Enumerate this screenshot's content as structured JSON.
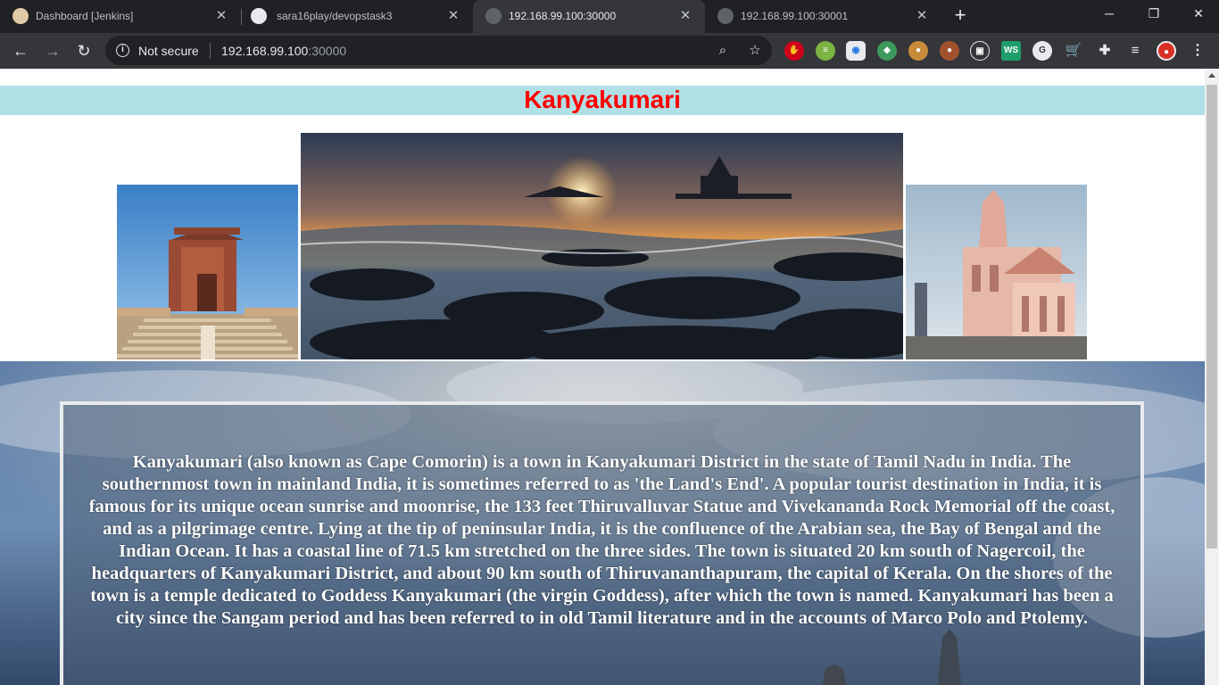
{
  "browser": {
    "tabs": [
      {
        "title": "Dashboard [Jenkins]",
        "active": false
      },
      {
        "title": "sara16play/devopstask3",
        "active": false
      },
      {
        "title": "192.168.99.100:30000",
        "active": true
      },
      {
        "title": "192.168.99.100:30001",
        "active": false
      }
    ],
    "address_bar": {
      "security_label": "Not secure",
      "host": "192.168.99.100",
      "port": ":30000"
    }
  },
  "page": {
    "title": "Kanyakumari",
    "description": "Kanyakumari (also known as Cape Comorin) is a town in Kanyakumari District in the state of Tamil Nadu in India. The southernmost town in mainland India, it is sometimes referred to as 'the Land's End'. A popular tourist destination in India, it is famous for its unique ocean sunrise and moonrise, the 133 feet Thiruvalluvar Statue and Vivekananda Rock Memorial off the coast, and as a pilgrimage centre. Lying at the tip of peninsular India, it is the confluence of the Arabian sea, the Bay of Bengal and the Indian Ocean. It has a coastal line of 71.5 km stretched on the three sides. The town is situated 20 km south of Nagercoil, the headquarters of Kanyakumari District, and about 90 km south of Thiruvananthapuram, the capital of Kerala. On the shores of the town is a temple dedicated to Goddess Kanyakumari (the virgin Goddess), after which the town is named. Kanyakumari has been a city since the Sangam period and has been referred to in old Tamil literature and in the accounts of Marco Polo and Ptolemy."
  },
  "colors": {
    "title_text": "#ff0000",
    "title_band": "#b0e0e6",
    "chrome_dark": "#202124",
    "chrome_toolbar": "#35363a"
  }
}
